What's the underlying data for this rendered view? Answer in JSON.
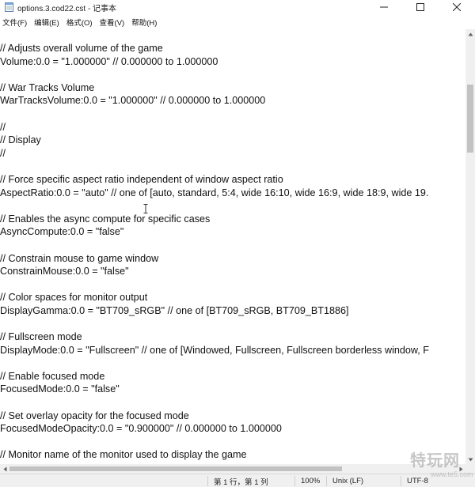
{
  "window": {
    "title": "options.3.cod22.cst - 记事本"
  },
  "menu": [
    {
      "label": "文件(F)"
    },
    {
      "label": "编辑(E)"
    },
    {
      "label": "格式(O)"
    },
    {
      "label": "查看(V)"
    },
    {
      "label": "帮助(H)"
    }
  ],
  "lines": [
    "// Adjusts overall volume of the game",
    "Volume:0.0 = \"1.000000\" // 0.000000 to 1.000000",
    "",
    "// War Tracks Volume",
    "WarTracksVolume:0.0 = \"1.000000\" // 0.000000 to 1.000000",
    "",
    "//",
    "// Display",
    "//",
    "",
    "// Force specific aspect ratio independent of window aspect ratio",
    "AspectRatio:0.0 = \"auto\" // one of [auto, standard, 5:4, wide 16:10, wide 16:9, wide 18:9, wide 19.",
    "",
    "// Enables the async compute for specific cases",
    "AsyncCompute:0.0 = \"false\"",
    "",
    "// Constrain mouse to game window",
    "ConstrainMouse:0.0 = \"false\"",
    "",
    "// Color spaces for monitor output",
    "DisplayGamma:0.0 = \"BT709_sRGB\" // one of [BT709_sRGB, BT709_BT1886]",
    "",
    "// Fullscreen mode",
    "DisplayMode:0.0 = \"Fullscreen\" // one of [Windowed, Fullscreen, Fullscreen borderless window, F",
    "",
    "// Enable focused mode",
    "FocusedMode:0.0 = \"false\"",
    "",
    "// Set overlay opacity for the focused mode",
    "FocusedModeOpacity:0.0 = \"0.900000\" // 0.000000 to 1.000000",
    "",
    "// Monitor name of the monitor used to display the game"
  ],
  "status": {
    "position": "第 1 行，第 1 列",
    "zoom": "100%",
    "line_ending": "Unix (LF)",
    "encoding": "UTF-8"
  },
  "watermark": {
    "text": "特玩网",
    "sub": "www.te5.com"
  },
  "colors": {
    "scroll_thumb": "#c2c2c2",
    "statusbar_bg": "#f0f0f0"
  }
}
